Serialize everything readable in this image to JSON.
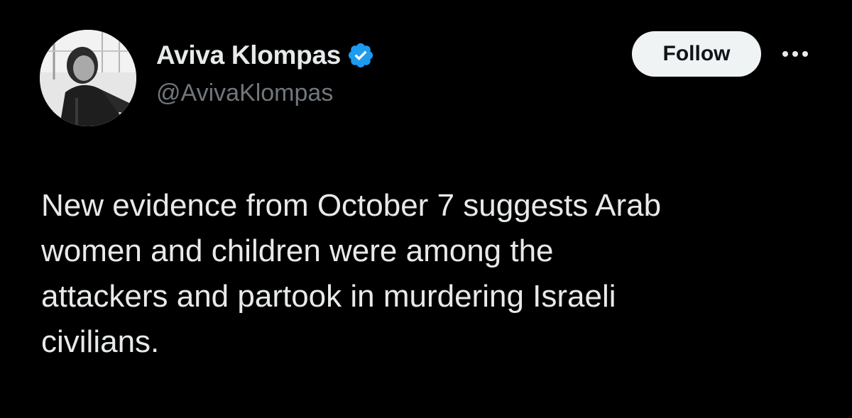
{
  "tweet": {
    "author": {
      "display_name": "Aviva Klompas",
      "handle": "@AvivaKlompas",
      "verified": true,
      "verified_icon": "verified-badge-icon",
      "avatar_icon": "profile-photo"
    },
    "follow_label": "Follow",
    "more_icon": "more-options-icon",
    "text": "New evidence from October 7 suggests Arab\nwomen and children were among the\nattackers and partook in murdering Israeli\ncivilians."
  },
  "colors": {
    "background": "#000000",
    "text_primary": "#e7e9ea",
    "text_secondary": "#71767b",
    "verified_blue": "#1d9bf0",
    "follow_bg": "#eff3f4",
    "follow_text": "#0f1419"
  }
}
